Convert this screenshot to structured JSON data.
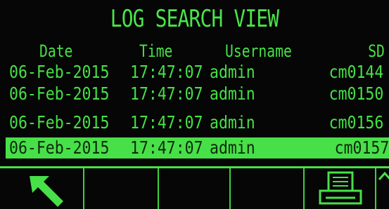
{
  "screen": {
    "title": "LOG SEARCH VIEW",
    "columns": {
      "date": "Date",
      "time": "Time",
      "username": "Username",
      "sd": "SD"
    },
    "rows": [
      {
        "date": "06-Feb-2015",
        "time": "17:47:07",
        "username": "admin",
        "sd": "cm0144"
      },
      {
        "date": "06-Feb-2015",
        "time": "17:47:07",
        "username": "admin",
        "sd": "cm0150"
      },
      {
        "date": "06-Feb-2015",
        "time": "17:47:07",
        "username": "admin",
        "sd": "cm0156"
      },
      {
        "date": "06-Feb-2015",
        "time": "17:47:07",
        "username": "admin",
        "sd": "cm0157"
      }
    ],
    "selected_row": 4
  },
  "softkeys": [
    {
      "icon": "exit-arrow-icon"
    },
    {
      "icon": ""
    },
    {
      "icon": ""
    },
    {
      "icon": ""
    },
    {
      "icon": "printer-icon"
    },
    {
      "icon": "scroll-up-icon"
    }
  ],
  "colors": {
    "display_background": "#050605",
    "text_green": "#46e046",
    "highlight_green": "#48e048"
  }
}
